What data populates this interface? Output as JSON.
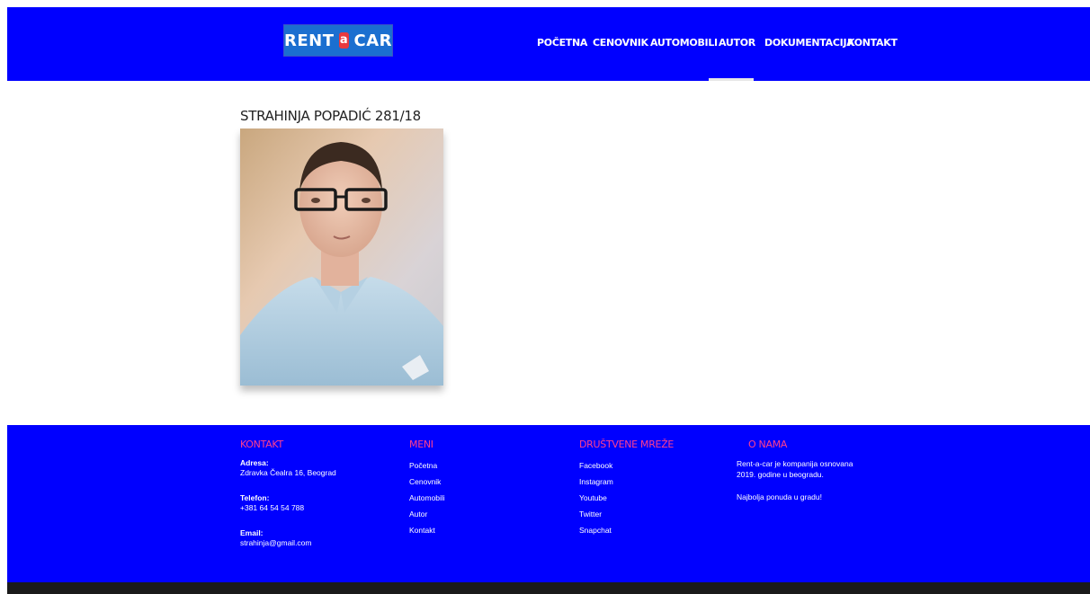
{
  "logo": {
    "left": "RENT",
    "mid": "a",
    "right": "CAR"
  },
  "nav": {
    "items": [
      {
        "label": "POČETNA"
      },
      {
        "label": "CENOVNIK"
      },
      {
        "label": "AUTOMOBILI"
      },
      {
        "label": "AUTOR"
      },
      {
        "label": "DOKUMENTACIJA"
      },
      {
        "label": "KONTAKT"
      }
    ],
    "active": "AUTOR"
  },
  "author": {
    "name": "STRAHINJA POPADIĆ 281/18"
  },
  "footer": {
    "kontakt": {
      "title": "KONTAKT",
      "address_label": "Adresa:",
      "address": "Zdravka Čealra 16, Beograd",
      "phone_label": "Telefon:",
      "phone": "+381 64 54 54 788",
      "email_label": "Email:",
      "email": "strahinja@gmail.com"
    },
    "meni": {
      "title": "MENI",
      "items": [
        "Početna",
        "Cenovnik",
        "Automobili",
        "Autor",
        "Kontakt"
      ]
    },
    "drustvene": {
      "title": "DRUŠTVENE MREŽE",
      "items": [
        "Facebook",
        "Instagram",
        "Youtube",
        "Twitter",
        "Snapchat"
      ]
    },
    "onama": {
      "title": "O NAMA",
      "text1": "Rent-a-car je kompanija osnovana",
      "text2": "2019. godine u beogradu.",
      "text3": "Najbolja ponuda u gradu!"
    }
  },
  "colors": {
    "brand_blue": "#0000ff",
    "accent_pink": "#ff3f8e",
    "logo_red": "#e8393f"
  }
}
